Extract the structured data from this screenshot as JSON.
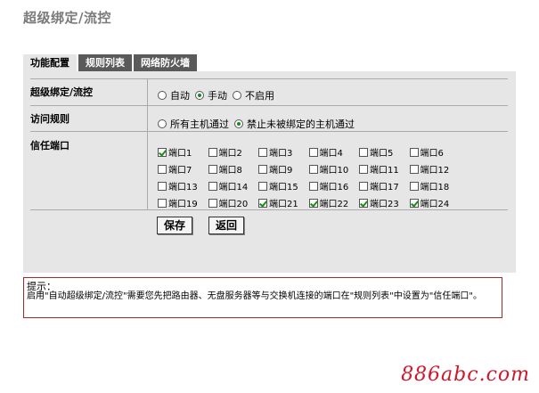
{
  "page": {
    "title": "超级绑定/流控"
  },
  "tabs": [
    {
      "label": "功能配置",
      "active": true
    },
    {
      "label": "规则列表",
      "active": false
    },
    {
      "label": "网络防火墙",
      "active": false
    }
  ],
  "form": {
    "binding": {
      "label": "超级绑定/流控",
      "options": [
        {
          "label": "自动",
          "selected": false
        },
        {
          "label": "手动",
          "selected": true
        },
        {
          "label": "不启用",
          "selected": false
        }
      ]
    },
    "access": {
      "label": "访问规则",
      "options": [
        {
          "label": "所有主机通过",
          "selected": false
        },
        {
          "label": "禁止未被绑定的主机通过",
          "selected": true
        }
      ]
    },
    "trusted_ports": {
      "label": "信任端口",
      "ports": [
        {
          "label": "端口1",
          "checked": true
        },
        {
          "label": "端口2",
          "checked": false
        },
        {
          "label": "端口3",
          "checked": false
        },
        {
          "label": "端口4",
          "checked": false
        },
        {
          "label": "端口5",
          "checked": false
        },
        {
          "label": "端口6",
          "checked": false
        },
        {
          "label": "端口7",
          "checked": false
        },
        {
          "label": "端口8",
          "checked": false
        },
        {
          "label": "端口9",
          "checked": false
        },
        {
          "label": "端口10",
          "checked": false
        },
        {
          "label": "端口11",
          "checked": false
        },
        {
          "label": "端口12",
          "checked": false
        },
        {
          "label": "端口13",
          "checked": false
        },
        {
          "label": "端口14",
          "checked": false
        },
        {
          "label": "端口15",
          "checked": false
        },
        {
          "label": "端口16",
          "checked": false
        },
        {
          "label": "端口17",
          "checked": false
        },
        {
          "label": "端口18",
          "checked": false
        },
        {
          "label": "端口19",
          "checked": false
        },
        {
          "label": "端口20",
          "checked": false
        },
        {
          "label": "端口21",
          "checked": true
        },
        {
          "label": "端口22",
          "checked": true
        },
        {
          "label": "端口23",
          "checked": true
        },
        {
          "label": "端口24",
          "checked": true
        }
      ]
    }
  },
  "buttons": {
    "save": "保存",
    "back": "返回"
  },
  "hint": {
    "title": "提示：",
    "text": "启用\"自动超级绑定/流控\"需要您先把路由器、无盘服务器等与交换机连接的端口在\"规则列表\"中设置为\"信任端口\"。"
  },
  "watermark": "886abc.com",
  "colors": {
    "tab_inactive": "#5a5a5a",
    "panel_bg": "#e6e6e6",
    "hint_border": "#a52a2a",
    "check": "#1a8a1a",
    "watermark": "#d1172c"
  }
}
